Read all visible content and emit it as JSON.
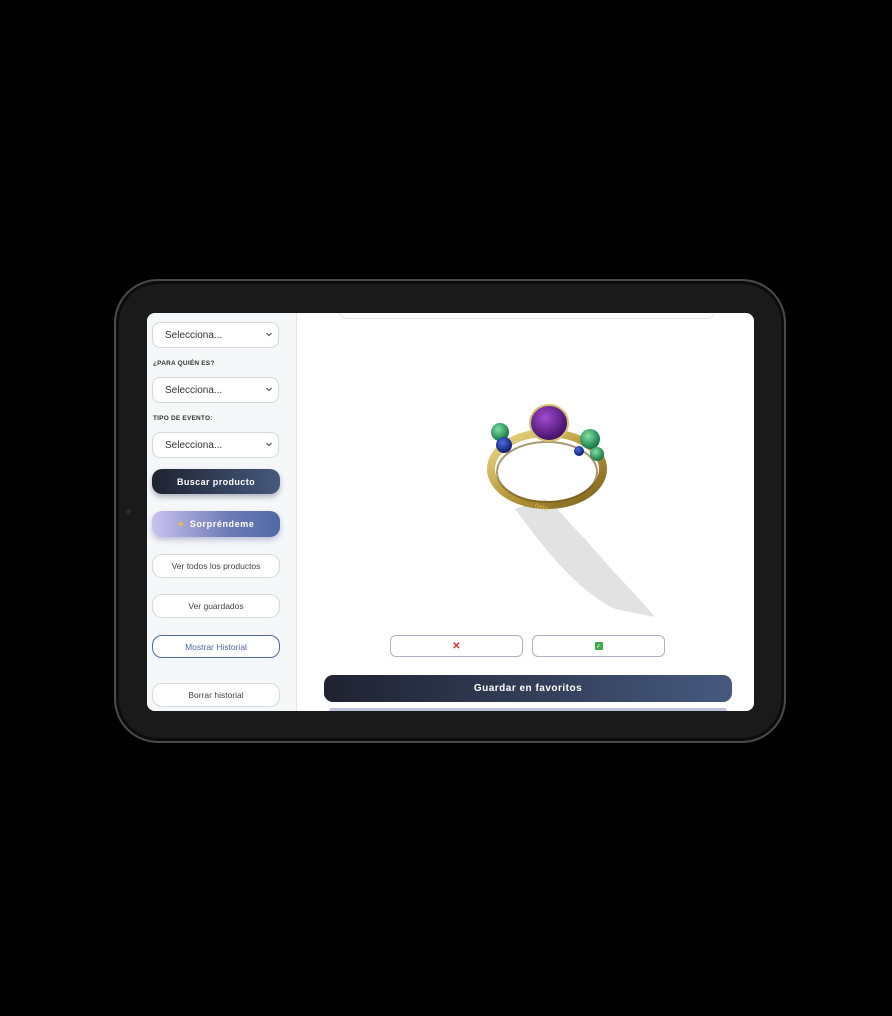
{
  "sidebar": {
    "select_top": "Selecciona...",
    "label_for_whom": "¿PARA QUIÉN ES?",
    "select_for_whom": "Selecciona...",
    "label_event_type": "TIPO DE EVENTO:",
    "select_event_type": "Selecciona...",
    "search_button": "Buscar producto",
    "surprise_button": "Sorpréndeme",
    "view_all_button": "Ver todos los productos",
    "view_saved_button": "Ver guardados",
    "show_history_button": "Mostrar Historial",
    "clear_history_button": "Borrar historial"
  },
  "main": {
    "product_image_icon": "ring-3d-render-icon",
    "dislike_symbol": "✕",
    "like_symbol": "✓",
    "save_favorites_button": "Guardar en favoritos"
  },
  "colors": {
    "accent_dark": "#1f2230",
    "accent_blue": "#4f6aa3",
    "dislike_red": "#d0342c",
    "like_green": "#3fae49"
  }
}
